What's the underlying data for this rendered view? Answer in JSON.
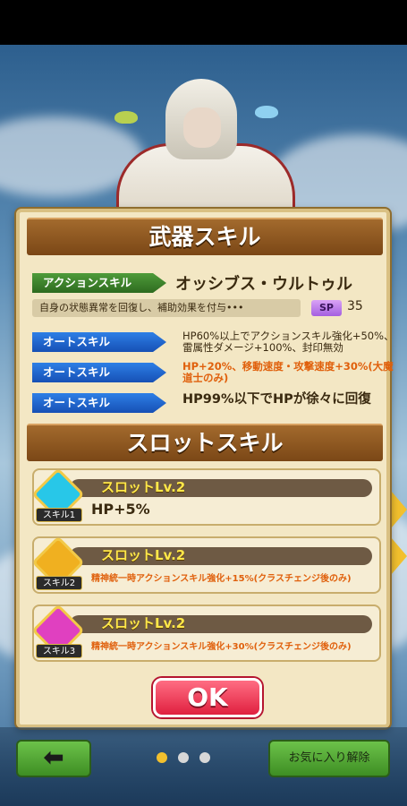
{
  "title": "武器スキル",
  "action_skill": {
    "tag": "アクションスキル",
    "name": "オッシブス・ウルトゥル",
    "description": "自身の状態異常を回復し、補助効果を付与•••",
    "sp_label": "SP",
    "sp_value": "35"
  },
  "auto_skills": [
    {
      "tag": "オートスキル",
      "text": "HP60%以上でアクションスキル強化+50%、雷属性ダメージ+100%、封印無効"
    },
    {
      "tag": "オートスキル",
      "text": "HP+20%、移動速度・攻撃速度+30%(大魔道士のみ)"
    },
    {
      "tag": "オートスキル",
      "text": "HP99%以下でHPが徐々に回復"
    }
  ],
  "slot_title": "スロットスキル",
  "slots": [
    {
      "label": "スロットLv.2",
      "gem_label": "スキル1",
      "desc": "HP+5%",
      "color": "#28c7e8"
    },
    {
      "label": "スロットLv.2",
      "gem_label": "スキル2",
      "desc": "精神統一時アクションスキル強化+15%(クラスチェンジ後のみ)",
      "color": "#f0b020"
    },
    {
      "label": "スロットLv.2",
      "gem_label": "スキル3",
      "desc": "精神統一時アクションスキル強化+30%(クラスチェンジ後のみ)",
      "color": "#e040c0"
    }
  ],
  "ok_label": "OK",
  "back_icon": "arrow-left-icon",
  "back_glyph": "⬅",
  "fav_label": "お気に入り解除",
  "page_dots": {
    "count": 3,
    "active": 0
  }
}
